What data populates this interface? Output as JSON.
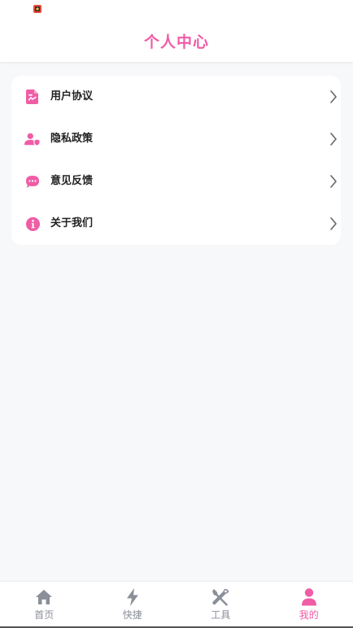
{
  "header": {
    "title": "个人中心"
  },
  "menu": {
    "items": [
      {
        "label": "用户协议",
        "icon": "document-icon"
      },
      {
        "label": "隐私政策",
        "icon": "user-shield-icon"
      },
      {
        "label": "意见反馈",
        "icon": "chat-bubble-icon"
      },
      {
        "label": "关于我们",
        "icon": "info-icon"
      }
    ]
  },
  "tabbar": {
    "tabs": [
      {
        "label": "首页",
        "icon": "home-icon",
        "active": false
      },
      {
        "label": "快捷",
        "icon": "lightning-icon",
        "active": false
      },
      {
        "label": "工具",
        "icon": "tools-icon",
        "active": false
      },
      {
        "label": "我的",
        "icon": "person-icon",
        "active": true
      }
    ]
  },
  "colors": {
    "accent": "#f05ca6",
    "inactive": "#8a8f99",
    "background": "#f7f8fa",
    "card": "#ffffff"
  }
}
